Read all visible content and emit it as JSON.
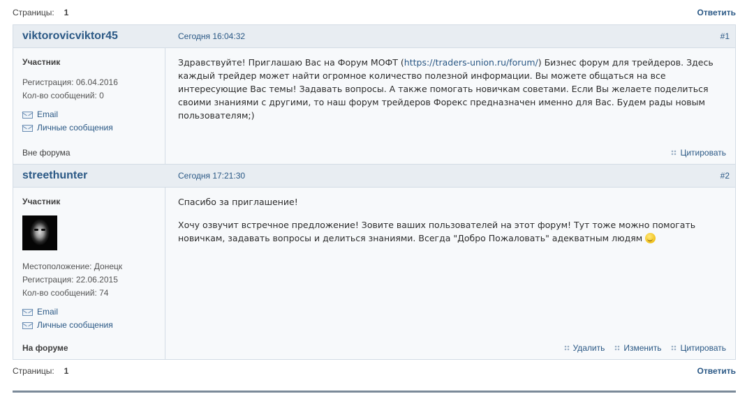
{
  "pagination": {
    "label": "Страницы:",
    "current": "1",
    "reply_label": "Ответить"
  },
  "posts": [
    {
      "author": "viktorovicviktor45",
      "date": "Сегодня 16:04:32",
      "number": "#1",
      "user_title": "Участник",
      "registration": "Регистрация: 06.04.2016",
      "message_count": "Кол-во сообщений: 0",
      "email_label": "Email",
      "pm_label": "Личные сообщения",
      "status": "Вне форума",
      "text_before_link": "Здравствуйте! Приглашаю Вас на Форум МОФТ (",
      "link": "https://traders-union.ru/forum/",
      "text_after_link": ") Бизнес форум для трейдеров. Здесь каждый трейдер может найти огромное количество полезной информации. Вы можете общаться на все интересующие Вас темы! Задавать вопросы. А также помогать новичкам советами. Если Вы желаете поделиться своими знаниями с другими, то наш форум трейдеров Форекс предназначен именно для Вас. Будем рады новым пользователям;)",
      "quote_label": "Цитировать"
    },
    {
      "author": "streethunter",
      "date": "Сегодня 17:21:30",
      "number": "#2",
      "user_title": "Участник",
      "location": "Местоположение: Донецк",
      "registration": "Регистрация: 22.06.2015",
      "message_count": "Кол-во сообщений: 74",
      "email_label": "Email",
      "pm_label": "Личные сообщения",
      "status": "На форуме",
      "paragraph1": "Спасибо за приглашение!",
      "paragraph2": "Хочу озвучит встречное предложение! Зовите ваших пользователей на этот форум! Тут тоже можно помогать новичкам, задавать вопросы и делиться знаниями. Всегда \"Добро Пожаловать\" адекватным людям",
      "delete_label": "Удалить",
      "edit_label": "Изменить",
      "quote_label": "Цитировать"
    }
  ],
  "icons": {
    "mail": "mail-icon",
    "action": "dots-icon",
    "smiley": "smiley-icon"
  },
  "colors": {
    "link": "#2a5885",
    "header_bg": "#e8edf2",
    "border": "#d3dce5",
    "post_bg": "#f7f9fb"
  }
}
